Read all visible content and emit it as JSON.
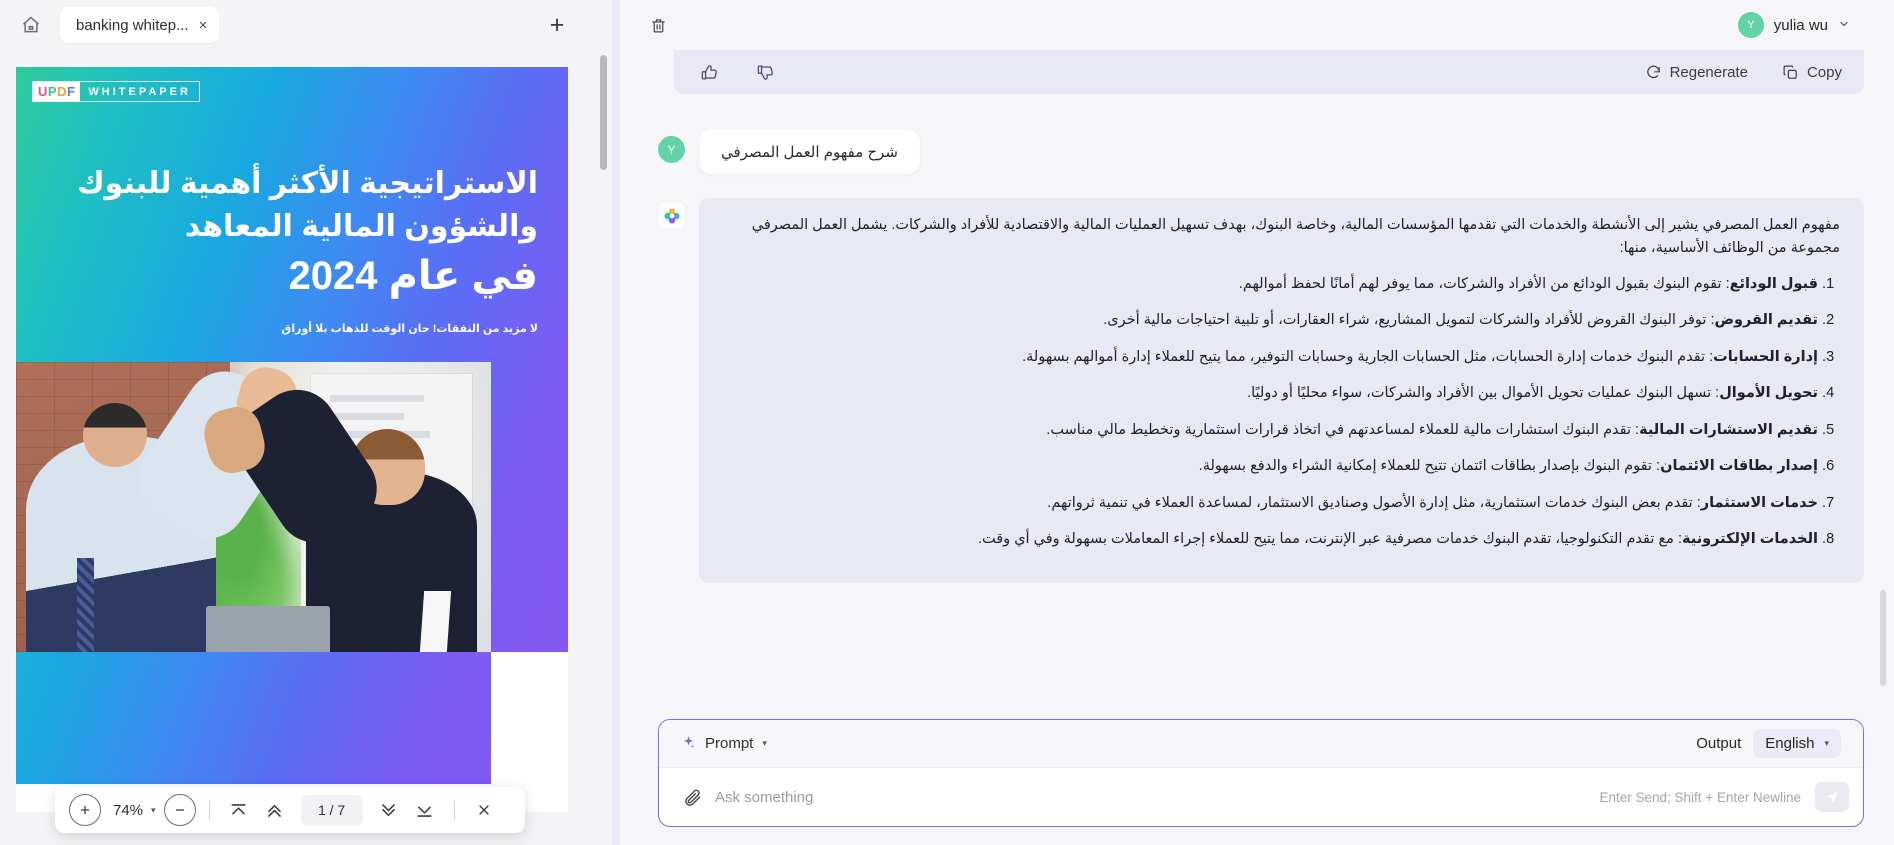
{
  "pdf": {
    "tab": {
      "label": "banking whitep...",
      "close": "×"
    },
    "new_tab": "+",
    "document": {
      "badge_updf": "UPDF",
      "badge_kind": "WHITEPAPER",
      "title_line1": "الاستراتيجية الأكثر أهمية للبنوك",
      "title_line2": "والشؤون المالية المعاهد",
      "title_line3": "في عام 2024",
      "subtitle": "لا مزيد من النفقات! حان الوقت للذهاب بلا أوراق"
    },
    "toolbar": {
      "zoom_in": "+",
      "zoom_level": "74%",
      "zoom_caret": "▾",
      "zoom_out": "−",
      "first_page": "first-page",
      "prev_page": "prev-page",
      "page_indicator": "1 / 7",
      "next_page": "next-page",
      "last_page": "last-page",
      "close": "×"
    }
  },
  "chat": {
    "header": {
      "user_initial": "Y",
      "user_name": "yulia wu",
      "caret": "⌄"
    },
    "message_actions": {
      "thumbs_up": "thumbs-up",
      "thumbs_down": "thumbs-down",
      "regenerate": "Regenerate",
      "copy": "Copy"
    },
    "user_message": {
      "initial": "Y",
      "text": "شرح مفهوم العمل المصرفي"
    },
    "ai_message": {
      "intro": "مفهوم العمل المصرفي يشير إلى الأنشطة والخدمات التي تقدمها المؤسسات المالية، وخاصة البنوك، بهدف تسهيل العمليات المالية والاقتصادية للأفراد والشركات. يشمل العمل المصرفي مجموعة من الوظائف الأساسية، منها:",
      "items": [
        {
          "term": "قبول الودائع",
          "desc": ": تقوم البنوك بقبول الودائع من الأفراد والشركات، مما يوفر لهم أمانًا لحفظ أموالهم."
        },
        {
          "term": "تقديم القروض",
          "desc": ": توفر البنوك القروض للأفراد والشركات لتمويل المشاريع، شراء العقارات، أو تلبية احتياجات مالية أخرى."
        },
        {
          "term": "إدارة الحسابات",
          "desc": ": تقدم البنوك خدمات إدارة الحسابات، مثل الحسابات الجارية وحسابات التوفير، مما يتيح للعملاء إدارة أموالهم بسهولة."
        },
        {
          "term": "تحويل الأموال",
          "desc": ": تسهل البنوك عمليات تحويل الأموال بين الأفراد والشركات، سواء محليًا أو دوليًا."
        },
        {
          "term": "تقديم الاستشارات المالية",
          "desc": ": تقدم البنوك استشارات مالية للعملاء لمساعدتهم في اتخاذ قرارات استثمارية وتخطيط مالي مناسب."
        },
        {
          "term": "إصدار بطاقات الائتمان",
          "desc": ": تقوم البنوك بإصدار بطاقات ائتمان تتيح للعملاء إمكانية الشراء والدفع بسهولة."
        },
        {
          "term": "خدمات الاستثمار",
          "desc": ": تقدم بعض البنوك خدمات استثمارية، مثل إدارة الأصول وصناديق الاستثمار، لمساعدة العملاء في تنمية ثرواتهم."
        },
        {
          "term": "الخدمات الإلكترونية",
          "desc": ": مع تقدم التكنولوجيا، تقدم البنوك خدمات مصرفية عبر الإنترنت، مما يتيح للعملاء إجراء المعاملات بسهولة وفي أي وقت."
        }
      ]
    },
    "composer": {
      "prompt_label": "Prompt",
      "prompt_caret": "▾",
      "output_label": "Output",
      "language": "English",
      "language_caret": "▾",
      "input_value": "",
      "input_placeholder": "Ask something",
      "hint": "Enter Send; Shift + Enter Newline"
    }
  },
  "colors": {
    "accent": "#7b6ee8",
    "ai_bubble": "#e9e8f5",
    "avatar_green": "#63d2a6",
    "app_bg": "#f6f6fa"
  }
}
